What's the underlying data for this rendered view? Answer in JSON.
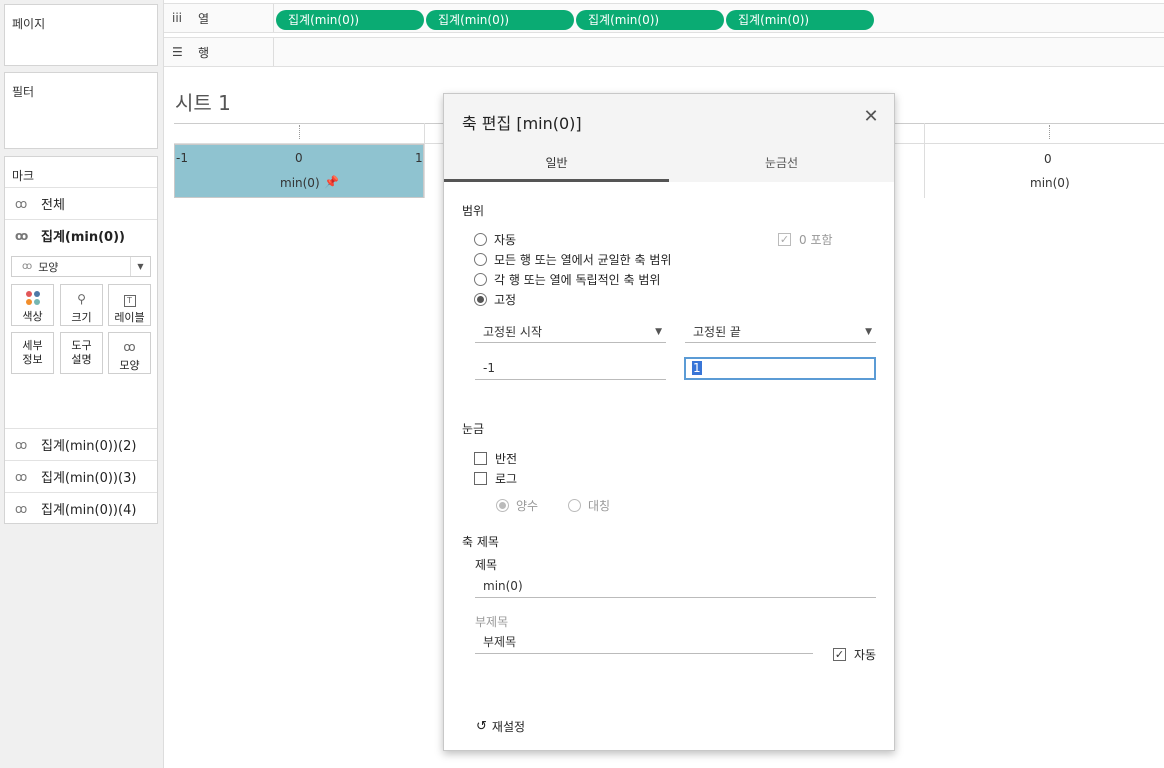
{
  "left": {
    "pages_title": "페이지",
    "filters_title": "필터",
    "marks": {
      "title": "마크",
      "rows": [
        {
          "label": "전체"
        },
        {
          "label": "집계(min(0))"
        }
      ],
      "mark_type": "모양",
      "buttons": [
        {
          "label": "색상",
          "icon": "color-dots-icon"
        },
        {
          "label": "크기",
          "icon": "size-icon"
        },
        {
          "label": "레이블",
          "icon": "label-icon"
        },
        {
          "label": "세부\n정보",
          "icon": "detail-icon"
        },
        {
          "label": "도구\n설명",
          "icon": "tooltip-icon"
        },
        {
          "label": "모양",
          "icon": "shape-icon"
        }
      ],
      "extra_rows": [
        {
          "label": "집계(min(0))(2)"
        },
        {
          "label": "집계(min(0))(3)"
        },
        {
          "label": "집계(min(0))(4)"
        }
      ]
    }
  },
  "shelves": {
    "columns_label": "열",
    "rows_label": "행",
    "pills": [
      "집계(min(0))",
      "집계(min(0))",
      "집계(min(0))",
      "집계(min(0))"
    ]
  },
  "view": {
    "sheet_title": "시트 1",
    "axis1": {
      "min": "-1",
      "mid": "0",
      "max": "1",
      "title": "min(0)",
      "pin_icon": "pin-icon"
    },
    "axis4": {
      "mid": "0",
      "title": "min(0)"
    }
  },
  "dialog": {
    "title": "축 편집 [min(0)]",
    "tabs": [
      "일반",
      "눈금선"
    ],
    "range": {
      "heading": "범위",
      "options": [
        "자동",
        "모든 행 또는 열에서 균일한 축 범위",
        "각 행 또는 열에 독립적인 축 범위",
        "고정"
      ],
      "selected": "고정",
      "include_zero": "0 포함",
      "start_dropdown": "고정된 시작",
      "end_dropdown": "고정된 끝",
      "start_value": "-1",
      "end_value": "1"
    },
    "scale": {
      "heading": "눈금",
      "reversed": "반전",
      "log": "로그",
      "positive": "양수",
      "symmetric": "대칭"
    },
    "axis_title": {
      "heading": "축 제목",
      "title_label": "제목",
      "title_value": "min(0)",
      "subtitle_label": "부제목",
      "subtitle_placeholder": "부제목",
      "auto": "자동"
    },
    "reset": "재설정"
  }
}
